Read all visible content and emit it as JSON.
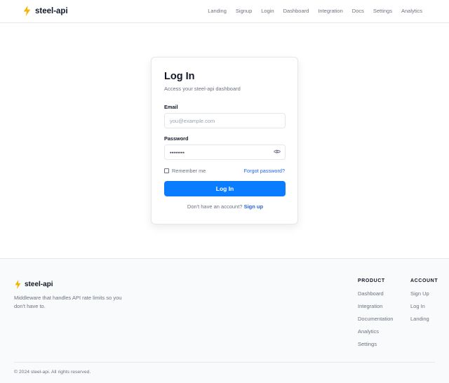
{
  "header": {
    "brand": "steel-api",
    "nav": [
      "Landing",
      "Signup",
      "Login",
      "Dashboard",
      "Integration",
      "Docs",
      "Settings",
      "Analytics"
    ]
  },
  "login": {
    "title": "Log In",
    "subtitle": "Access your steel-api dashboard",
    "email_label": "Email",
    "email_placeholder": "you@example.com",
    "password_label": "Password",
    "password_value": "••••••••",
    "remember_label": "Remember me",
    "forgot_label": "Forgot password?",
    "submit_label": "Log In",
    "no_account_text": "Don't have an account?",
    "signup_link": "Sign up"
  },
  "footer": {
    "brand": "steel-api",
    "description": "Middleware that handles API rate limits so you don't have to.",
    "product": {
      "heading": "PRODUCT",
      "links": [
        "Dashboard",
        "Integration",
        "Documentation",
        "Analytics",
        "Settings"
      ]
    },
    "account": {
      "heading": "ACCOUNT",
      "links": [
        "Sign Up",
        "Log In",
        "Landing"
      ]
    },
    "copyright": "© 2024 steel-api. All rights reserved."
  },
  "colors": {
    "accent": "#0a7cff",
    "link": "#2563eb",
    "bolt": "#f5b400"
  },
  "icons": {
    "brand": "lightning-bolt-icon",
    "password_toggle": "eye-icon"
  }
}
